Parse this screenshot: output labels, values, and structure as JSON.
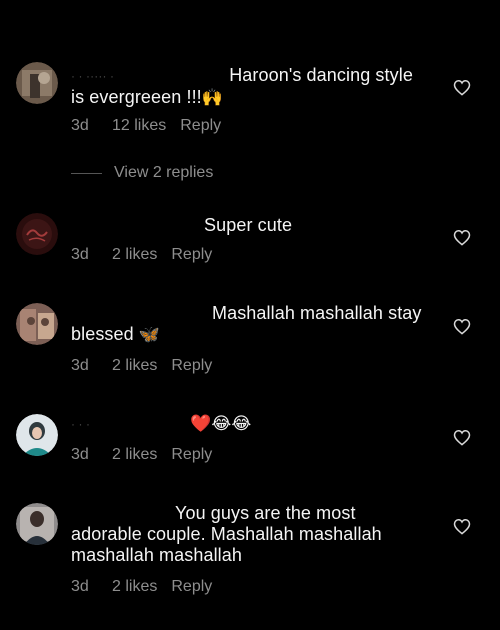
{
  "comments": [
    {
      "username_fragment": "·  ·  ·····  ·",
      "text": "Haroon's dancing style is evergreeen !!!",
      "emoji": "🙌",
      "time": "3d",
      "likes": "12 likes",
      "reply_label": "Reply",
      "view_replies": "View 2 replies"
    },
    {
      "username_fragment": "",
      "text": "Super cute",
      "emoji": "",
      "time": "3d",
      "likes": "2 likes",
      "reply_label": "Reply"
    },
    {
      "username_fragment": "",
      "text": "Mashallah mashallah stay blessed",
      "emoji": "🦋",
      "time": "3d",
      "likes": "2 likes",
      "reply_label": "Reply"
    },
    {
      "username_fragment": "·  ·  ·",
      "text": "",
      "emoji": "❤️😂😂",
      "time": "3d",
      "likes": "2 likes",
      "reply_label": "Reply"
    },
    {
      "username_fragment": "",
      "text": "You guys are the most adorable couple. Mashallah mashallah mashallah mashallah",
      "emoji": "",
      "time": "3d",
      "likes": "2 likes",
      "reply_label": "Reply"
    }
  ],
  "colors": {
    "background": "#000000",
    "text": "#f5f5f5",
    "secondary": "#8e8e8e",
    "heart_outline": "#d8d8d8"
  },
  "icons": {
    "like": "heart-outline-icon"
  }
}
